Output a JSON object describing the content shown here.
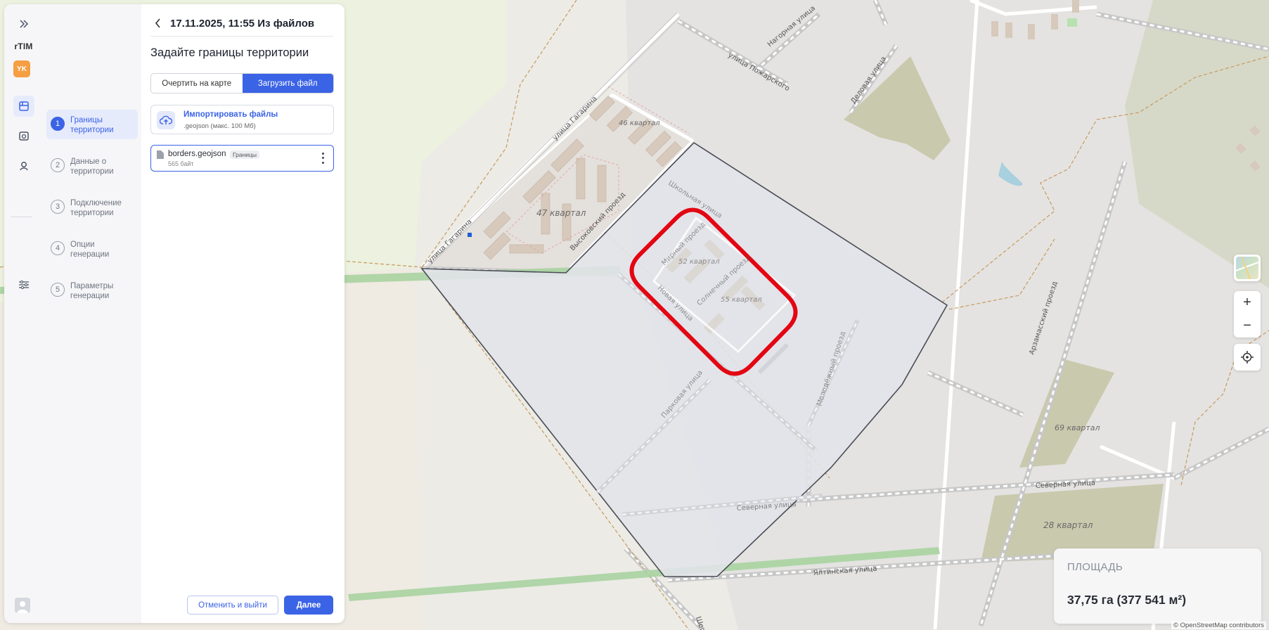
{
  "rail": {
    "brand": "rTIM",
    "avatar": "YK",
    "icons": [
      "expand-icon",
      "projects-icon",
      "library-icon",
      "users-icon",
      "settings-icon",
      "user-icon"
    ]
  },
  "header": {
    "title": "17.11.2025, 11:55 Из файлов"
  },
  "steps": [
    {
      "num": "1",
      "label": "Границы территории"
    },
    {
      "num": "2",
      "label": "Данные о территории"
    },
    {
      "num": "3",
      "label": "Подключение территории"
    },
    {
      "num": "4",
      "label": "Опции генерации"
    },
    {
      "num": "5",
      "label": "Параметры генерации"
    }
  ],
  "main": {
    "heading": "Задайте границы территории",
    "tabs": [
      {
        "label": "Очертить на карте",
        "selected": false
      },
      {
        "label": "Загрузить файл",
        "selected": true
      }
    ],
    "import": {
      "title": "Импортировать файлы",
      "hint": ".geojson (макс. 100 Мб)"
    },
    "file": {
      "name": "borders.geojson",
      "tag": "Границы",
      "size": "565 байт"
    },
    "cancel_label": "Отменить и выйти",
    "next_label": "Далее"
  },
  "map": {
    "labels": {
      "q46": "46 квартал",
      "q47": "47 квартал",
      "q52": "52 квартал",
      "q55": "55 квартал",
      "q69": "69 квартал",
      "q28": "28 квартал",
      "gagarina1": "улица Гагарина",
      "gagarina2": "улица Гагарина",
      "vysokovsky": "Высоковский проезд",
      "nagornaya": "Нагорная улица",
      "pozharskogo": "улица Пожарского",
      "delovaya": "Деловая улица",
      "shkolnaya": "Школьная улица",
      "mirny": "Мирный проезд",
      "solnechny": "Солнечный проезд",
      "novaya": "Новая улица",
      "parkovaya": "Парковая улица",
      "molodezhny": "Молодёжный проезд",
      "severnaya1": "Северная улица",
      "severnaya2": "Северная улица",
      "yaltinskaya": "Ялтинская улица",
      "arzamassky": "Арзамасский проезд",
      "shosse": "Шоссе"
    },
    "zoom_in": "+",
    "zoom_out": "−",
    "attribution": "© OpenStreetMap contributors"
  },
  "area": {
    "caption": "ПЛОЩАДЬ",
    "value": "37,75 га (377 541 м²)"
  },
  "colors": {
    "accent": "#3b63e6",
    "highlight": "#e30613",
    "polygon_fill": "#e3e4e9",
    "polygon_stroke": "#4a4d55"
  }
}
